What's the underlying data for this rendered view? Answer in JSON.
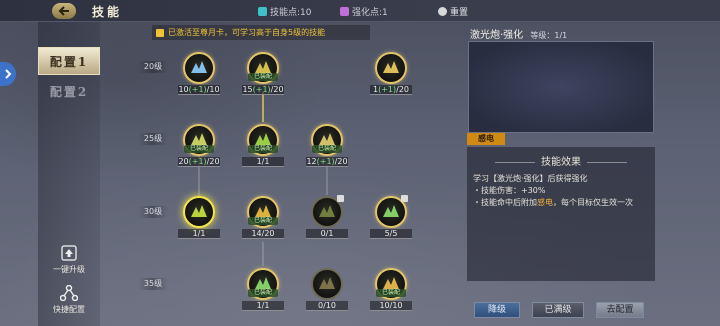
{
  "header": {
    "title": "技能",
    "skill_points_label": "技能点:10",
    "enhance_points_label": "强化点:1",
    "reset_label": "重置"
  },
  "sidebar": {
    "config1": "配置1",
    "config2": "配置2",
    "upgrade_label": "一键升级",
    "quick_config_label": "快捷配置"
  },
  "notice": "已激活至尊月卡，可学习高于自身5级的技能",
  "tree": {
    "levels": [
      "20级",
      "25级",
      "30级",
      "35级"
    ],
    "equipped_label": "已装配",
    "skills": [
      {
        "count_main": "10",
        "count_plus": "(+1)",
        "count_max": "/10",
        "color": "#8fd0ff",
        "equipped": false
      },
      {
        "count_main": "15",
        "count_plus": "(+1)",
        "count_max": "/20",
        "color": "#e6d050",
        "equipped": true
      },
      {
        "count_main": "1",
        "count_plus": "(+1)",
        "count_max": "/20",
        "color": "#f2d060",
        "equipped": false
      },
      {
        "count_main": "20",
        "count_plus": "(+1)",
        "count_max": "/20",
        "color": "#d8e06a",
        "equipped": true
      },
      {
        "count_main": "1/1",
        "count_plus": "",
        "count_max": "",
        "color": "#a6e04a",
        "equipped": true
      },
      {
        "count_main": "12",
        "count_plus": "(+1)",
        "count_max": "/20",
        "color": "#e8d070",
        "equipped": true
      },
      {
        "count_main": "1/1",
        "count_plus": "",
        "count_max": "",
        "color": "#c8e840",
        "equipped": false
      },
      {
        "count_main": "14/20",
        "count_plus": "",
        "count_max": "",
        "color": "#f0c040",
        "equipped": true
      },
      {
        "count_main": "0/1",
        "count_plus": "",
        "count_max": "",
        "color": "#7a8a40",
        "equipped": false
      },
      {
        "count_main": "5/5",
        "count_plus": "",
        "count_max": "",
        "color": "#90e070",
        "equipped": false
      },
      {
        "count_main": "1/1",
        "count_plus": "",
        "count_max": "",
        "color": "#8fe070",
        "equipped": true
      },
      {
        "count_main": "0/10",
        "count_plus": "",
        "count_max": "",
        "color": "#8a7a50",
        "equipped": false
      },
      {
        "count_main": "10/10",
        "count_plus": "",
        "count_max": "",
        "color": "#f0c050",
        "equipped": true
      }
    ]
  },
  "detail": {
    "title": "激光炮·强化",
    "level": "等级：1/1",
    "tag": "感电",
    "effect_header": "技能效果",
    "line1": "学习【激光炮·强化】后获得强化",
    "line2": "・技能伤害：+30%",
    "line3a": "・技能命中后附加",
    "line3_hl": "感电",
    "line3b": "，每个目标仅生效一次"
  },
  "buttons": {
    "downgrade": "降级",
    "maxed": "已满级",
    "to_config": "去配置"
  }
}
